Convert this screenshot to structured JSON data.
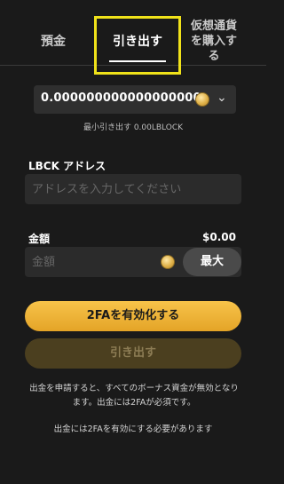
{
  "tabs": {
    "deposit": "預金",
    "withdraw": "引き出す",
    "buy_crypto": "仮想通貨を購入する"
  },
  "currency": {
    "amount": "0.000000000000000000",
    "min_withdraw": "最小引き出す 0.00LBLOCK"
  },
  "address": {
    "label": "LBCK アドレス",
    "placeholder": "アドレスを入力してください"
  },
  "amount": {
    "label": "金額",
    "balance": "$0.00",
    "placeholder": "金額",
    "max_label": "最大"
  },
  "buttons": {
    "enable_2fa": "2FAを有効化する",
    "withdraw": "引き出す"
  },
  "notices": {
    "bonus_warning": "出金を申請すると、すべてのボーナス資金が無効となります。出金には2FAが必須です。",
    "require_2fa": "出金には2FAを有効にする必要があります"
  },
  "colors": {
    "accent": "#f0b43a",
    "highlight_box": "#f0e21a",
    "background": "#1a1a1a"
  },
  "icons": [
    "coin-icon",
    "chevron-down-icon"
  ]
}
